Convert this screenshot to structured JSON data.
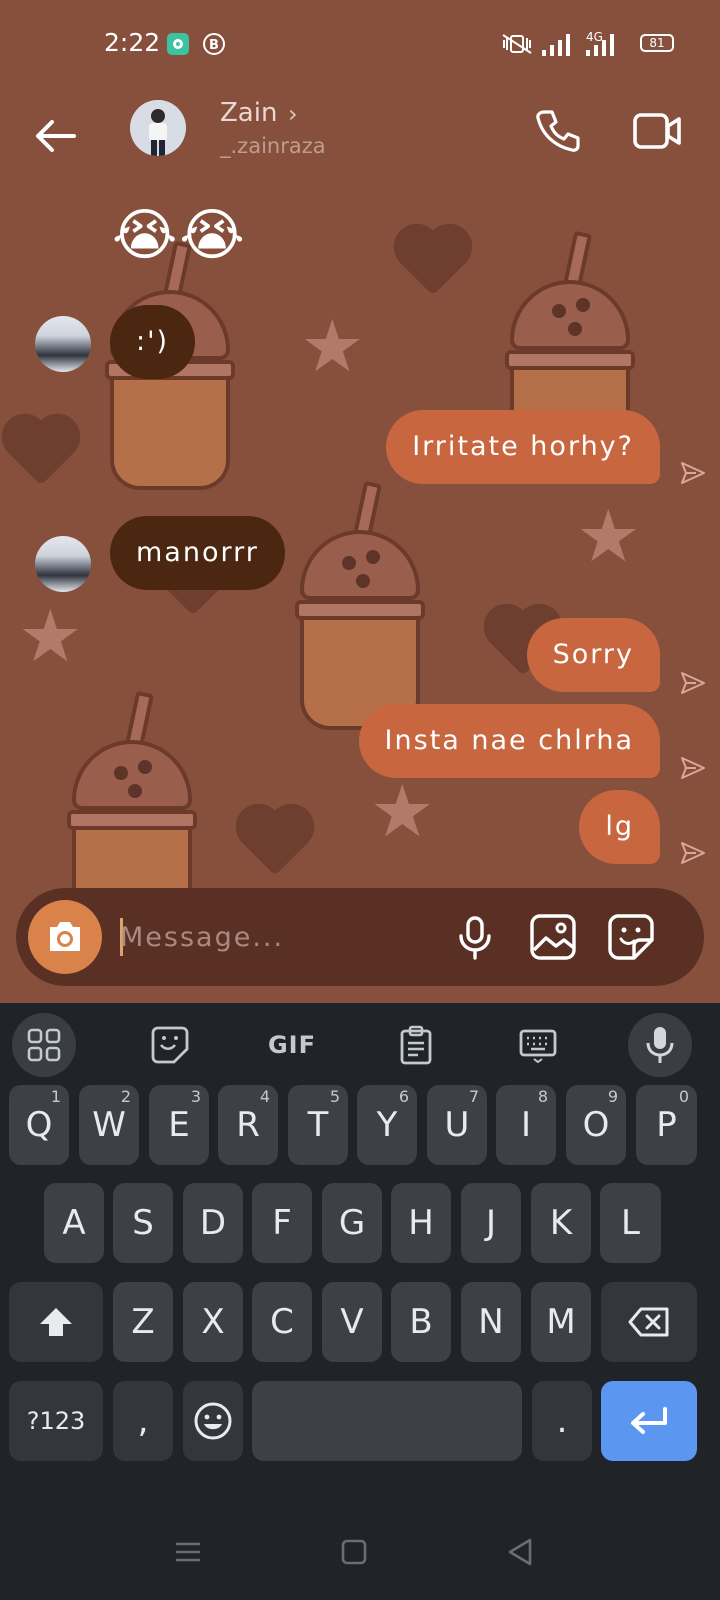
{
  "status_bar": {
    "time": "2:22",
    "network": "4G",
    "battery": "81"
  },
  "header": {
    "contact_name": "Zain",
    "chevron": "›",
    "username": "_.zainraza",
    "icons": [
      "back-arrow-icon",
      "phone-icon",
      "video-camera-icon"
    ]
  },
  "messages": [
    {
      "type": "emoji",
      "direction": "in",
      "text": "😭😭"
    },
    {
      "type": "text",
      "direction": "in",
      "text": ":')"
    },
    {
      "type": "text",
      "direction": "out",
      "text": "Irritate horhy?"
    },
    {
      "type": "text",
      "direction": "in",
      "text": "manorrr"
    },
    {
      "type": "text",
      "direction": "out",
      "text": "Sorry"
    },
    {
      "type": "text",
      "direction": "out",
      "text": "Insta nae chlrha"
    },
    {
      "type": "text",
      "direction": "out",
      "text": "lg"
    }
  ],
  "composer": {
    "placeholder": "Message...",
    "icons": [
      "camera-icon",
      "microphone-icon",
      "gallery-icon",
      "sticker-icon"
    ]
  },
  "keyboard": {
    "toolbar": {
      "gif_label": "GIF"
    },
    "row1": [
      {
        "label": "Q",
        "hint": "1"
      },
      {
        "label": "W",
        "hint": "2"
      },
      {
        "label": "E",
        "hint": "3"
      },
      {
        "label": "R",
        "hint": "4"
      },
      {
        "label": "T",
        "hint": "5"
      },
      {
        "label": "Y",
        "hint": "6"
      },
      {
        "label": "U",
        "hint": "7"
      },
      {
        "label": "I",
        "hint": "8"
      },
      {
        "label": "O",
        "hint": "9"
      },
      {
        "label": "P",
        "hint": "0"
      }
    ],
    "row2": [
      "A",
      "S",
      "D",
      "F",
      "G",
      "H",
      "J",
      "K",
      "L"
    ],
    "row3": [
      "Z",
      "X",
      "C",
      "V",
      "B",
      "N",
      "M"
    ],
    "bottom": {
      "symbols": "?123",
      "comma": ",",
      "period": "."
    }
  },
  "colors": {
    "wallpaper": "#87503d",
    "incoming_bubble": "#4b2611",
    "outgoing_bubble": "#c8663f",
    "composer": "#5a3024",
    "camera_button": "#d9824a",
    "keyboard": "#202428",
    "key": "#3d4147",
    "enter_key": "#5b96f0"
  }
}
